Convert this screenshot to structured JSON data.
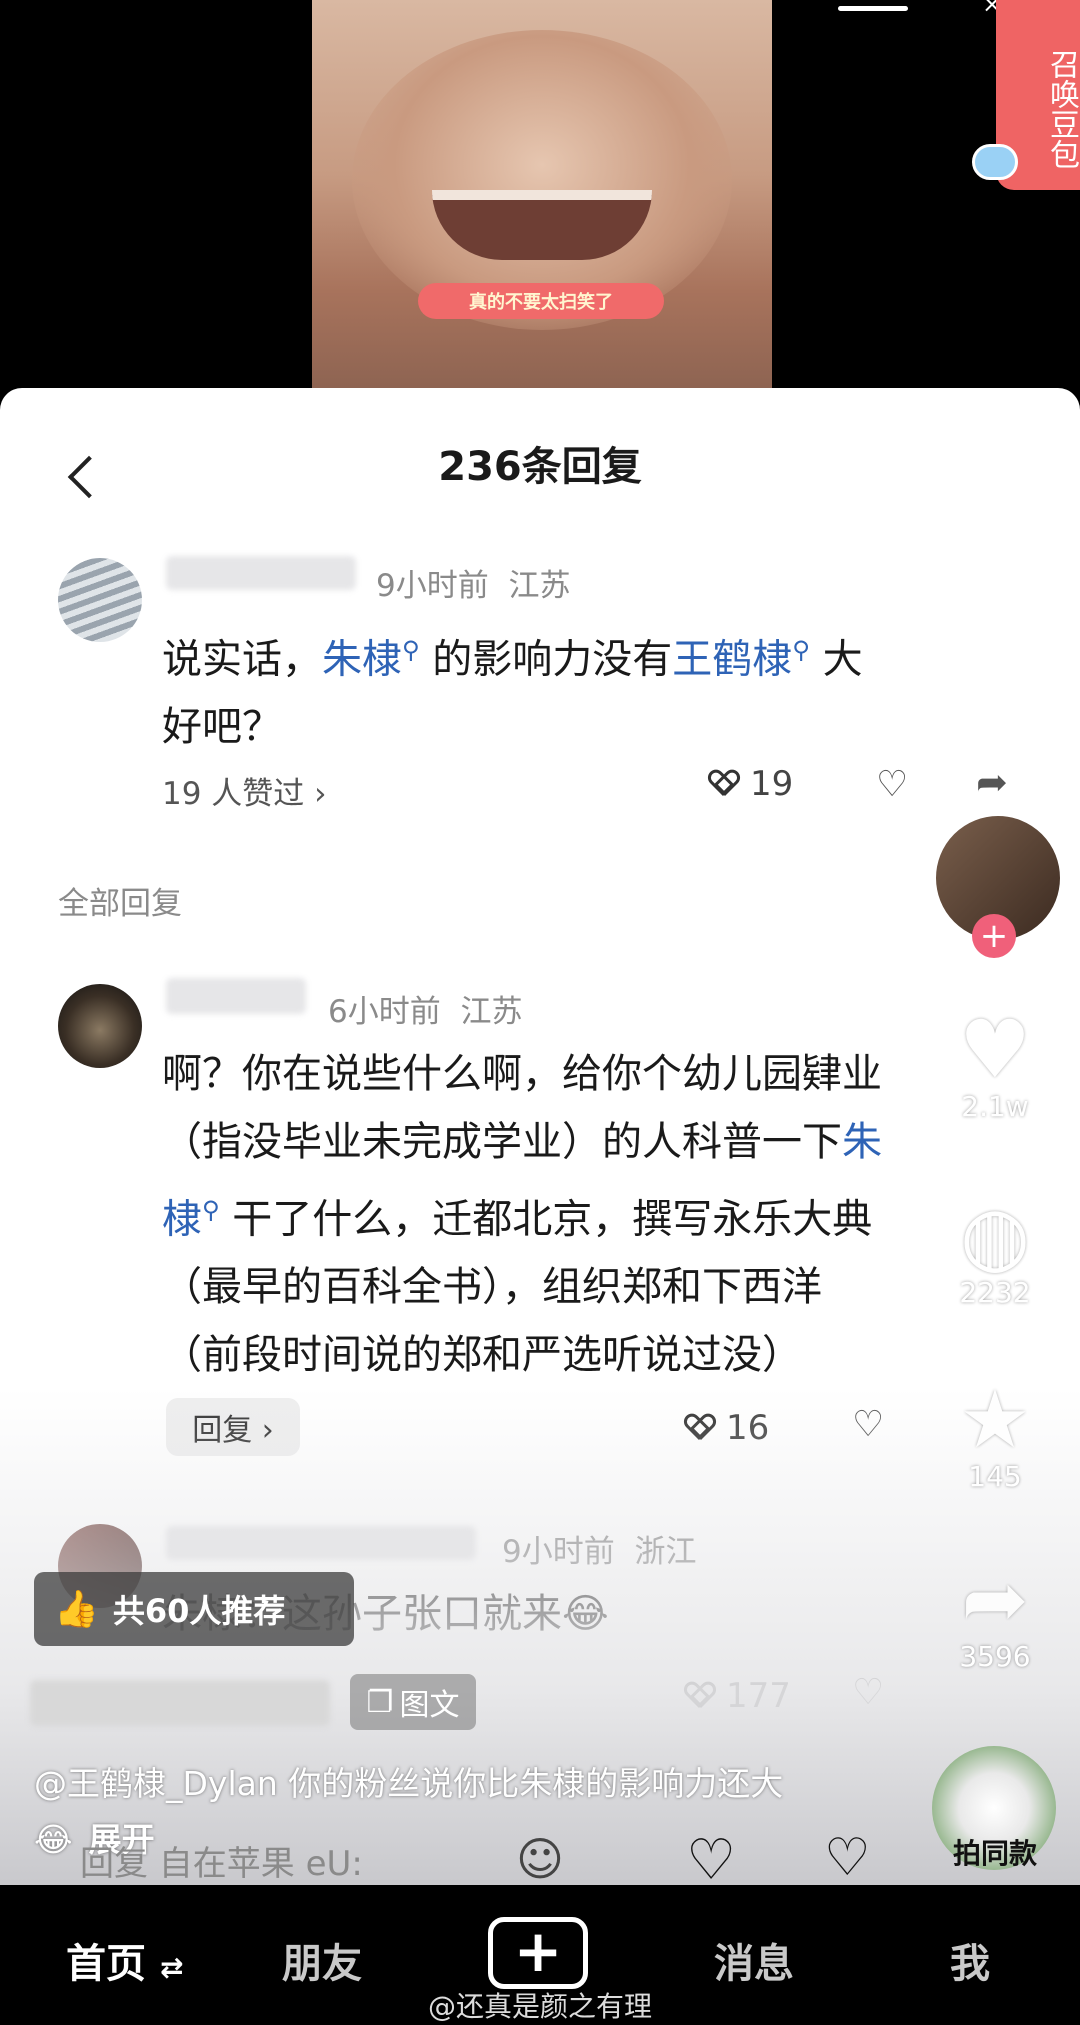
{
  "video": {
    "subtitle": "真的不要太扫笑了",
    "summon_label": "召唤豆包"
  },
  "sheet": {
    "title": "236条回复",
    "section_label": "全部回复"
  },
  "comments": [
    {
      "time": "9小时前",
      "region": "江苏",
      "line1_a": "说实话，",
      "link1": "朱棣",
      "line1_b": " 的影响力没有",
      "link2": "王鹤棣",
      "line1_c": " 大",
      "line2": "好吧？",
      "liked_by": "19 人赞过 ›",
      "likes": "19"
    },
    {
      "time": "6小时前",
      "region": "江苏",
      "line1": "啊？你在说些什么啊，给你个幼儿园肄业",
      "line2_a": "（指没毕业未完成学业）的人科普一下",
      "link1": "朱",
      "line3_link": "棣",
      "line3_b": " 干了什么，迁都北京，撰写永乐大典",
      "line4": "（最早的百科全书），组织郑和下西洋",
      "line5": "（前段时间说的郑和严选听说过没）",
      "reply_label": "回复 ›",
      "likes": "16"
    },
    {
      "time": "9小时前",
      "region": "浙江",
      "text": "朱棣：这孙子张口就来😂",
      "likes": "177"
    }
  ],
  "side": {
    "likes": "2.1w",
    "favorites": "2232",
    "stars": "145",
    "shares": "3596"
  },
  "overlay": {
    "recommend": "共60人推荐",
    "tag": "图文",
    "caption": "@王鹤棣_Dylan 你的粉丝说你比朱棣的影响力还大😂",
    "expand": "展开",
    "input_placeholder": "回复 自在苹果 eU:",
    "same_style": "拍同款"
  },
  "tabbar": {
    "home": "首页",
    "friends": "朋友",
    "messages": "消息",
    "me": "我",
    "watermark": "@还真是颜之有理"
  }
}
